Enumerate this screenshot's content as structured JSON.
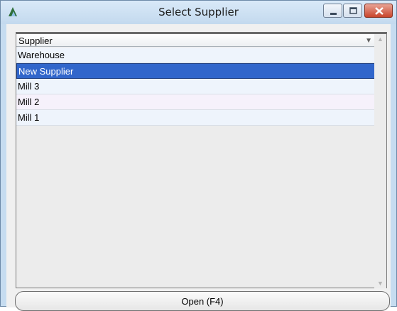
{
  "window": {
    "title": "Select Supplier",
    "icon": "triangle-app-icon"
  },
  "list": {
    "column_header": "Supplier",
    "items": [
      {
        "label": "Warehouse",
        "selected": false
      },
      {
        "label": "New Supplier",
        "selected": true
      },
      {
        "label": "Mill 3",
        "selected": false
      },
      {
        "label": "Mill 2",
        "selected": false
      },
      {
        "label": "Mill 1",
        "selected": false
      }
    ]
  },
  "actions": {
    "open_label": "Open (F4)"
  },
  "colors": {
    "selection": "#3166cb",
    "close_button": "#c9452c"
  }
}
